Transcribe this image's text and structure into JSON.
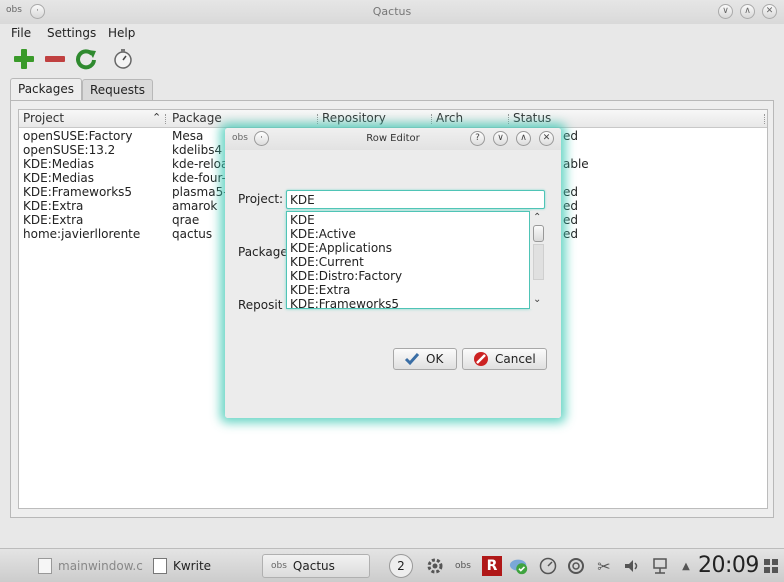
{
  "window": {
    "title": "Qactus",
    "app_icon": "obs-logo-icon"
  },
  "menubar": {
    "file": "File",
    "settings": "Settings",
    "help": "Help"
  },
  "toolbar": {
    "icons": [
      "add-icon",
      "remove-icon",
      "refresh-icon",
      "timer-icon"
    ]
  },
  "tabs": {
    "packages": "Packages",
    "requests": "Requests"
  },
  "table": {
    "headers": {
      "project": "Project",
      "package": "Package",
      "repository": "Repository",
      "arch": "Arch",
      "status": "Status"
    },
    "rows": [
      {
        "project": "openSUSE:Factory",
        "package": "Mesa",
        "status_tail": "ed"
      },
      {
        "project": "openSUSE:13.2",
        "package": "kdelibs4",
        "status_tail": ""
      },
      {
        "project": "KDE:Medias",
        "package": "kde-reload",
        "status_tail": "able"
      },
      {
        "project": "KDE:Medias",
        "package": "kde-four-l",
        "status_tail": ""
      },
      {
        "project": "KDE:Frameworks5",
        "package": "plasma5-",
        "status_tail": "ed"
      },
      {
        "project": "KDE:Extra",
        "package": "amarok",
        "status_tail": "ed"
      },
      {
        "project": "KDE:Extra",
        "package": "qrae",
        "status_tail": "ed"
      },
      {
        "project": "home:javierllorente",
        "package": "qactus",
        "status_tail": "ed"
      }
    ]
  },
  "dialog": {
    "title": "Row Editor",
    "project_label": "Project:",
    "project_value": "KDE",
    "package_label": "Package",
    "repository_label": "Reposit",
    "completions": [
      "KDE",
      "KDE:Active",
      "KDE:Applications",
      "KDE:Current",
      "KDE:Distro:Factory",
      "KDE:Extra",
      "KDE:Frameworks5"
    ],
    "ok_label": "OK",
    "cancel_label": "Cancel",
    "title_buttons": {
      "help": "?",
      "minimize": "∨",
      "maximize": "∧",
      "close": "✕"
    }
  },
  "taskbar": {
    "tasks": [
      {
        "label": "mainwindow.c",
        "icon": "document-icon"
      },
      {
        "label": "Kwrite",
        "icon": "kwrite-icon"
      },
      {
        "label": "Qactus",
        "icon": "obs-logo-icon"
      }
    ],
    "pager": "2",
    "clock": "20:09"
  },
  "colors": {
    "accent": "#3cc8b4",
    "add": "#3a9a2a",
    "remove": "#c04040",
    "cancel": "#cc2222"
  }
}
